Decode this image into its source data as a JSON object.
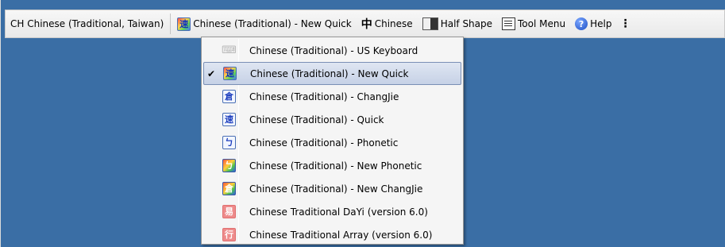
{
  "language_bar": {
    "language": "CH Chinese (Traditional, Taiwan)",
    "ime": {
      "label": "Chinese (Traditional) - New Quick",
      "icon": "quick-ime-icon"
    },
    "mode": {
      "glyph": "中",
      "label": "Chinese",
      "icon": "chinese-mode-icon"
    },
    "shape": {
      "label": "Half Shape",
      "icon": "half-shape-icon"
    },
    "tool_menu": {
      "label": "Tool Menu",
      "icon": "tool-menu-icon"
    },
    "help": {
      "label": "Help",
      "icon": "help-icon"
    },
    "overflow_glyph": "⋮"
  },
  "menu": {
    "items": [
      {
        "label": "Chinese (Traditional) - US Keyboard",
        "icon": "keyboard-icon",
        "glyph": "⌨",
        "style": "kb",
        "checked": false
      },
      {
        "label": "Chinese (Traditional) - New Quick",
        "icon": "new-quick-icon",
        "glyph": "速",
        "style": "quick-color",
        "checked": true
      },
      {
        "label": "Chinese (Traditional) - ChangJie",
        "icon": "changjie-icon",
        "glyph": "倉",
        "style": "plain",
        "checked": false
      },
      {
        "label": "Chinese (Traditional) - Quick",
        "icon": "quick-icon",
        "glyph": "速",
        "style": "plain",
        "checked": false
      },
      {
        "label": "Chinese (Traditional) - Phonetic",
        "icon": "phonetic-icon",
        "glyph": "ㄅ",
        "style": "plain",
        "checked": false
      },
      {
        "label": "Chinese (Traditional) - New Phonetic",
        "icon": "new-phonetic-icon",
        "glyph": "ㄅ",
        "style": "color",
        "checked": false
      },
      {
        "label": "Chinese (Traditional) - New ChangJie",
        "icon": "new-changjie-icon",
        "glyph": "倉",
        "style": "color",
        "checked": false
      },
      {
        "label": "Chinese Traditional DaYi (version 6.0)",
        "icon": "dayi-icon",
        "glyph": "易",
        "style": "red",
        "checked": false
      },
      {
        "label": "Chinese Traditional Array (version 6.0)",
        "icon": "array-icon",
        "glyph": "行",
        "style": "red",
        "checked": false
      }
    ],
    "check_glyph": "✔"
  }
}
